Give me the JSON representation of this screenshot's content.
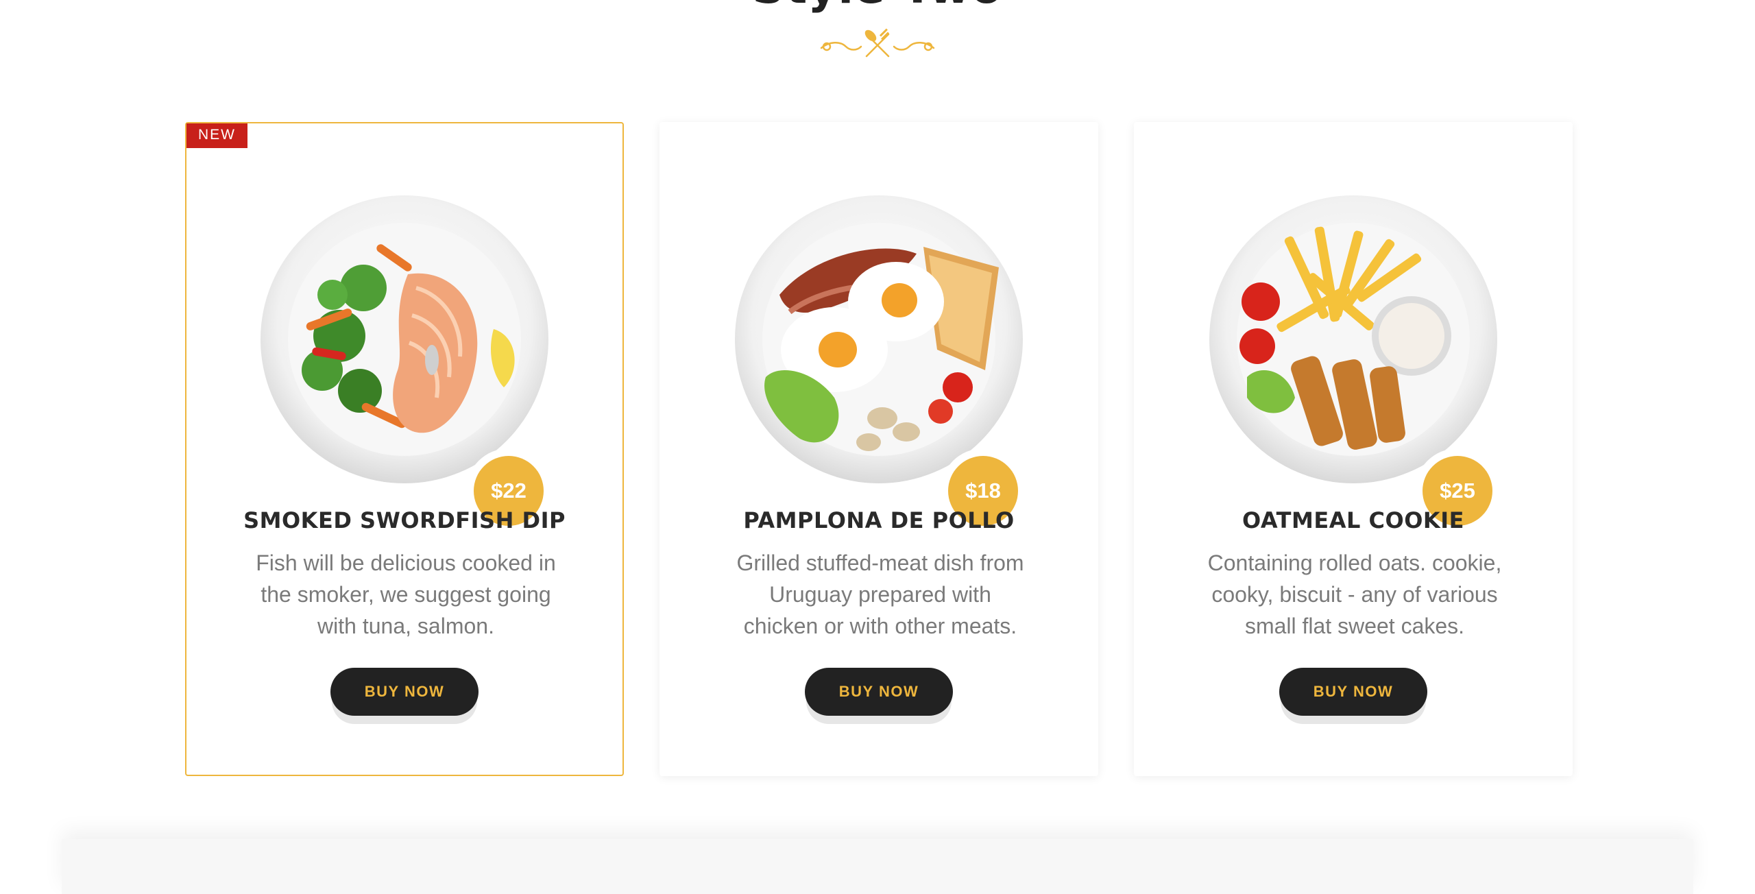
{
  "section": {
    "title": "Style Two"
  },
  "colors": {
    "accent": "#eeb63d",
    "badge_red": "#c8201a",
    "button_dark": "#222222",
    "text_dark": "#2a2a2a",
    "text_muted": "#7a7a7a"
  },
  "divider_icon": "fork-and-spoon-ornament-icon",
  "cards": [
    {
      "badge": "NEW",
      "price": "$22",
      "name": "SMOKED SWORDFISH DIP",
      "description": "Fish will be delicious cooked in the smoker, we suggest going with tuna, salmon.",
      "button": "BUY NOW",
      "image": "salmon-steak-with-vegetables-plate"
    },
    {
      "price": "$18",
      "name": "PAMPLONA DE POLLO",
      "description": "Grilled stuffed-meat dish from Uruguay prepared with chicken or with other meats.",
      "button": "BUY NOW",
      "image": "eggs-bacon-toast-breakfast-plate"
    },
    {
      "price": "$25",
      "name": "OATMEAL COOKIE",
      "description": "Containing rolled oats. cookie, cooky, biscuit - any of various small flat sweet cakes.",
      "button": "BUY NOW",
      "image": "fries-fish-sticks-dip-plate"
    }
  ]
}
